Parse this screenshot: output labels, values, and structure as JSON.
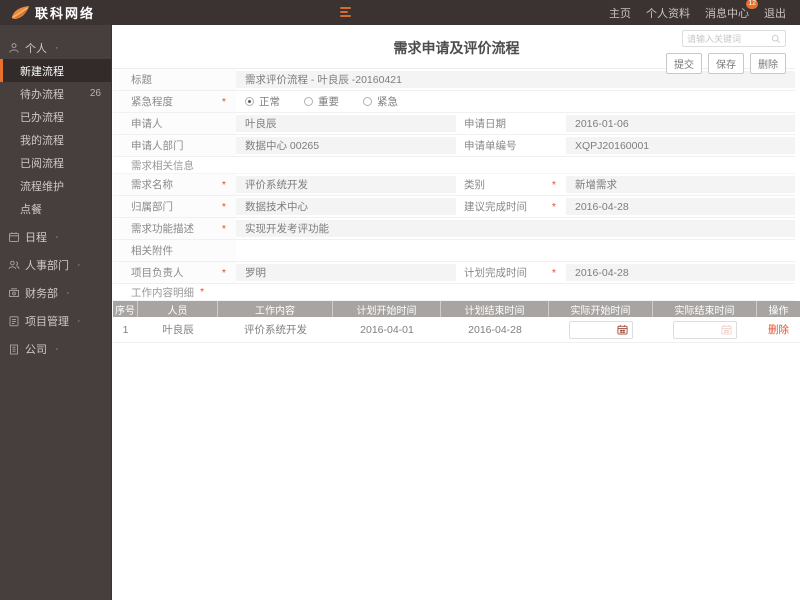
{
  "topbar": {
    "brand": "联科网络",
    "nav": [
      {
        "label": "主页"
      },
      {
        "label": "个人资料"
      },
      {
        "label": "消息中心",
        "badge": "12"
      },
      {
        "label": "退出"
      }
    ]
  },
  "sidebar": {
    "group_caret": "·",
    "items": [
      {
        "label": "个人"
      },
      {
        "label": "新建流程"
      },
      {
        "label": "待办流程",
        "badge": "26"
      },
      {
        "label": "已办流程"
      },
      {
        "label": "我的流程"
      },
      {
        "label": "已阅流程"
      },
      {
        "label": "流程维护"
      },
      {
        "label": "点餐"
      },
      {
        "label": "日程"
      },
      {
        "label": "人事部门"
      },
      {
        "label": "财务部"
      },
      {
        "label": "项目管理"
      },
      {
        "label": "公司"
      }
    ]
  },
  "header": {
    "title": "需求申请及评价流程",
    "search_placeholder": "请输入关键词",
    "buttons": {
      "submit": "提交",
      "save": "保存",
      "delete": "删除"
    }
  },
  "form": {
    "required_mark": "*",
    "rows": [
      {
        "label": "标题",
        "value": "需求评价流程 - 叶良辰 -20160421"
      },
      {
        "label": "紧急程度",
        "options": [
          "正常",
          "重要",
          "紧急"
        ],
        "selected": "正常"
      },
      {
        "left": {
          "label": "申请人",
          "value": "叶良辰"
        },
        "right": {
          "label": "申请日期",
          "value": "2016-01-06"
        }
      },
      {
        "left": {
          "label": "申请人部门",
          "value": "数据中心 00265"
        },
        "right": {
          "label": "申请单编号",
          "value": "XQPJ20160001"
        }
      },
      {
        "section": "需求相关信息"
      },
      {
        "left": {
          "label": "需求名称",
          "value": "评价系统开发"
        },
        "right": {
          "label": "类别",
          "value": "新增需求"
        }
      },
      {
        "left": {
          "label": "归属部门",
          "value": "数据技术中心"
        },
        "right": {
          "label": "建议完成时间",
          "value": "2016-04-28"
        }
      },
      {
        "label": "需求功能描述",
        "value": "实现开发考评功能"
      },
      {
        "label": "相关附件",
        "value": ""
      },
      {
        "left": {
          "label": "项目负责人",
          "value": "罗明"
        },
        "right": {
          "label": "计划完成时间",
          "value": "2016-04-28"
        }
      },
      {
        "section": "工作内容明细"
      }
    ]
  },
  "table": {
    "headers": [
      "序号",
      "人员",
      "工作内容",
      "计划开始时间",
      "计划结束时间",
      "实际开始时间",
      "实际结束时间",
      "操作"
    ],
    "rows": [
      {
        "cells": [
          "1",
          "叶良辰",
          "评价系统开发",
          "2016-04-01",
          "2016-04-28"
        ],
        "actual_start": "",
        "actual_end": "",
        "delete_label": "删除"
      }
    ]
  },
  "colors": {
    "accent": "#e8702d",
    "topbar_bg": "#3a3332",
    "sidebar_bg": "#463f3e",
    "table_header_bg": "#a8a4a1",
    "danger": "#e4502e"
  }
}
